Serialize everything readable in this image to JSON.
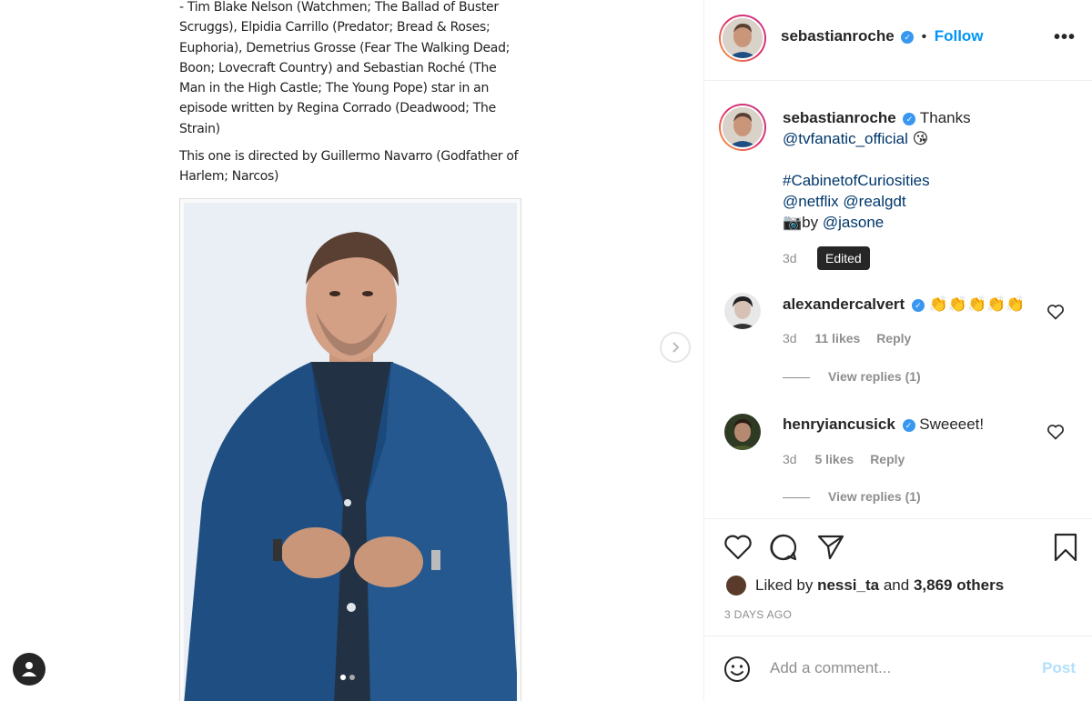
{
  "article": {
    "paragraph1": "- Tim Blake Nelson (Watchmen; The Ballad of Buster Scruggs), Elpidia Carrillo (Predator; Bread & Roses; Euphoria), Demetrius Grosse (Fear The Walking Dead; Boon; Lovecraft Country) and Sebastian Roché (The Man in the High Castle; The Young Pope) star in an episode written by Regina Corrado (Deadwood; The Strain)",
    "paragraph2": "This one is directed by Guillermo Navarro (Godfather of Harlem; Narcos)"
  },
  "header": {
    "username": "sebastianroche",
    "separator": "•",
    "follow_label": "Follow",
    "more_label": "•••"
  },
  "caption": {
    "username": "sebastianroche",
    "line1": "Thanks",
    "mention1": "@tvfanatic_official",
    "emoji1": "😘",
    "hashtag": "#CabinetofCuriosities",
    "mention2": "@netflix",
    "mention3": "@realgdt",
    "camera": "📷",
    "by_text": "by",
    "mention4": "@jasone",
    "time": "3d",
    "tooltip": "Edited"
  },
  "comments": [
    {
      "username": "alexandercalvert",
      "text": "👏👏👏👏👏",
      "time": "3d",
      "likes": "11 likes",
      "reply": "Reply",
      "view_replies": "View replies (1)"
    },
    {
      "username": "henryiancusick",
      "text": "Sweeeet!",
      "time": "3d",
      "likes": "5 likes",
      "reply": "Reply",
      "view_replies": "View replies (1)"
    }
  ],
  "likes": {
    "prefix": "Liked by",
    "user": "nessi_ta",
    "and": "and",
    "others": "3,869 others"
  },
  "timeago": "3 DAYS AGO",
  "add_comment": {
    "placeholder": "Add a comment...",
    "post_label": "Post"
  },
  "icons": {
    "heart": "heart-icon",
    "comment": "comment-icon",
    "share": "share-icon",
    "bookmark": "bookmark-icon",
    "smile": "smile-icon",
    "verified": "verified-badge-icon",
    "next": "chevron-right-icon",
    "profile": "user-icon"
  },
  "carousel": {
    "slides": 2,
    "active": 1
  },
  "colors": {
    "accent": "#0095f6",
    "link": "#00376b",
    "muted": "#8e8e8e",
    "verified": "#3897f0"
  }
}
